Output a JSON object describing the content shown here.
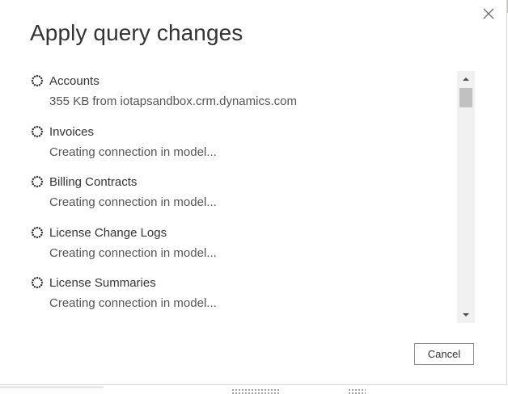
{
  "dialog": {
    "title": "Apply query changes",
    "close_icon": "close-icon",
    "cancel_label": "Cancel"
  },
  "queries": [
    {
      "name": "Accounts",
      "status": "355 KB from iotapsandbox.crm.dynamics.com",
      "icon": "loading-spinner-icon"
    },
    {
      "name": "Invoices",
      "status": "Creating connection in model...",
      "icon": "loading-spinner-icon"
    },
    {
      "name": "Billing Contracts",
      "status": "Creating connection in model...",
      "icon": "loading-spinner-icon"
    },
    {
      "name": "License Change Logs",
      "status": "Creating connection in model...",
      "icon": "loading-spinner-icon"
    },
    {
      "name": "License Summaries",
      "status": "Creating connection in model...",
      "icon": "loading-spinner-icon"
    }
  ],
  "scrollbar": {
    "up_icon": "scroll-up-arrow-icon",
    "down_icon": "scroll-down-arrow-icon"
  },
  "colors": {
    "text": "#333333",
    "status_text": "#555555",
    "scroll_track": "#f1f1f1",
    "scroll_thumb": "#c1c1c1",
    "button_border": "#8a8a8a"
  }
}
